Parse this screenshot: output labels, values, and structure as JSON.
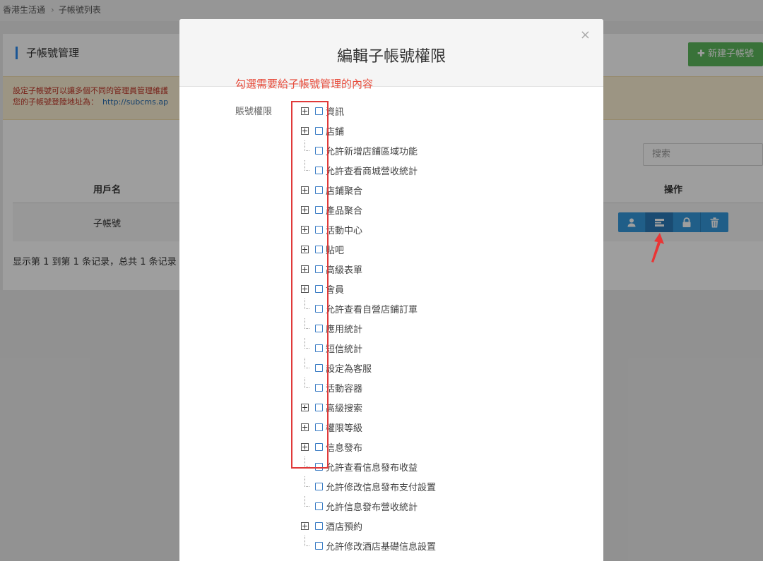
{
  "breadcrumb": {
    "home": "香港生活通",
    "current": "子帳號列表"
  },
  "panel": {
    "title": "子帳號管理",
    "new_button": "新建子帳號",
    "notice_line1": "設定子帳號可以讓多個不同的管理員管理維護",
    "notice_line2": "您的子帳號登陸地址為：",
    "notice_link": "http://subcms.ap",
    "search_placeholder": "搜索",
    "col_user": "用戶名",
    "col_ops": "操作",
    "row_user": "子帳號",
    "footer": "显示第 1 到第 1 条记录，总共 1 条记录"
  },
  "icons": [
    "user-icon",
    "list-icon",
    "lock-icon",
    "trash-icon"
  ],
  "colors": {
    "accent": "#3498db",
    "success": "#5cb85c",
    "highlight": "#e03a3a"
  },
  "modal": {
    "title": "編輯子帳號權限",
    "hint": "勾選需要給子帳號管理的內容",
    "label": "賬號權限",
    "tree": [
      {
        "label": "資訊",
        "expandable": true
      },
      {
        "label": "店鋪",
        "expandable": true
      },
      {
        "label": "允許新增店鋪區域功能",
        "expandable": false
      },
      {
        "label": "允許查看商城營收統計",
        "expandable": false
      },
      {
        "label": "店鋪聚合",
        "expandable": true
      },
      {
        "label": "產品聚合",
        "expandable": true
      },
      {
        "label": "活動中心",
        "expandable": true
      },
      {
        "label": "貼吧",
        "expandable": true
      },
      {
        "label": "高級表單",
        "expandable": true
      },
      {
        "label": "會員",
        "expandable": true
      },
      {
        "label": "允許查看自營店鋪訂單",
        "expandable": false
      },
      {
        "label": "應用統計",
        "expandable": false
      },
      {
        "label": "短信統計",
        "expandable": false
      },
      {
        "label": "設定為客服",
        "expandable": false
      },
      {
        "label": "活動容器",
        "expandable": false
      },
      {
        "label": "高級搜索",
        "expandable": true
      },
      {
        "label": "權限等級",
        "expandable": true
      },
      {
        "label": "信息發布",
        "expandable": true
      },
      {
        "label": "允許查看信息發布收益",
        "expandable": false
      },
      {
        "label": "允許修改信息發布支付設置",
        "expandable": false
      },
      {
        "label": "允許信息發布營收統計",
        "expandable": false
      },
      {
        "label": "酒店預約",
        "expandable": true
      },
      {
        "label": "允許修改酒店基礎信息設置",
        "expandable": false
      }
    ]
  }
}
